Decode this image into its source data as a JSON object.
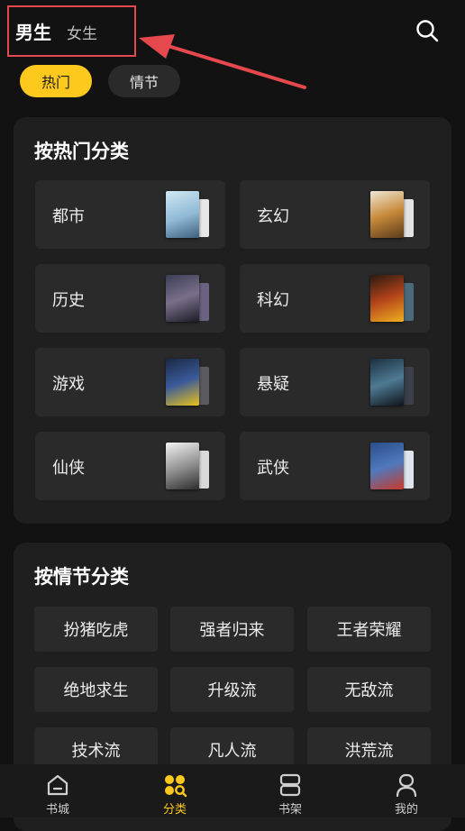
{
  "header": {
    "tab_male": "男生",
    "tab_female": "女生",
    "search_icon": "search-icon"
  },
  "filters": {
    "hot": "热门",
    "plot": "情节",
    "active": "hot",
    "active_color": "#fdc91c"
  },
  "hot_section": {
    "title": "按热门分类",
    "categories": [
      {
        "label": "都市",
        "cover_icon": "book-cover-urban"
      },
      {
        "label": "玄幻",
        "cover_icon": "book-cover-fantasy"
      },
      {
        "label": "历史",
        "cover_icon": "book-cover-history"
      },
      {
        "label": "科幻",
        "cover_icon": "book-cover-scifi"
      },
      {
        "label": "游戏",
        "cover_icon": "book-cover-game"
      },
      {
        "label": "悬疑",
        "cover_icon": "book-cover-mystery"
      },
      {
        "label": "仙侠",
        "cover_icon": "book-cover-xianxia"
      },
      {
        "label": "武侠",
        "cover_icon": "book-cover-wuxia"
      }
    ]
  },
  "plot_section": {
    "title": "按情节分类",
    "tags": [
      "扮猪吃虎",
      "强者归来",
      "王者荣耀",
      "绝地求生",
      "升级流",
      "无敌流",
      "技术流",
      "凡人流",
      "洪荒流"
    ]
  },
  "bottom_nav": {
    "items": [
      {
        "label": "书城",
        "icon": "home-icon"
      },
      {
        "label": "分类",
        "icon": "category-icon"
      },
      {
        "label": "书架",
        "icon": "bookshelf-icon"
      },
      {
        "label": "我的",
        "icon": "profile-icon"
      }
    ],
    "active_index": 1
  }
}
